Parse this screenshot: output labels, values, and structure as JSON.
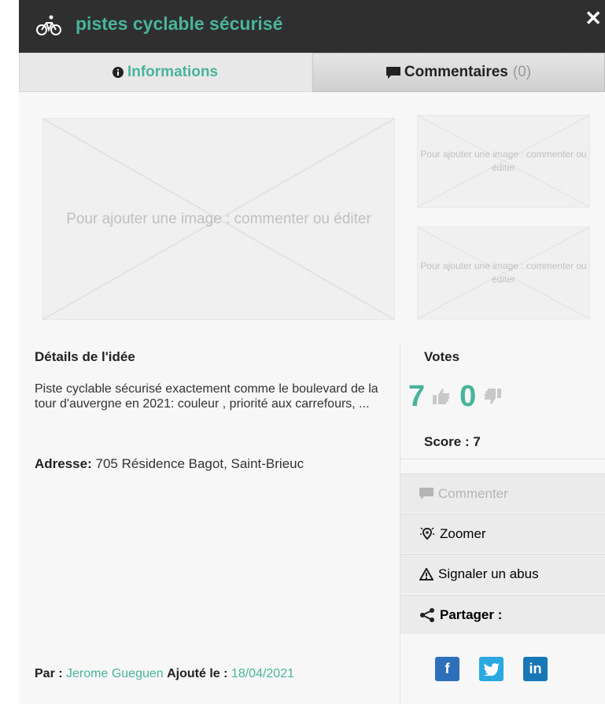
{
  "header": {
    "title": "pistes cyclable sécurisé",
    "close": "✕"
  },
  "tabs": {
    "info": "Informations",
    "comments": "Commentaires",
    "comments_count": "(0)"
  },
  "images": {
    "placeholder_main": "Pour ajouter une image : commenter ou éditer",
    "placeholder_small": "Pour ajouter une image : commenter ou éditer"
  },
  "details": {
    "title": "Détails de l'idée",
    "text": "Piste cyclable sécurisé exactement comme le boulevard de la tour d'auvergne en 2021: couleur , priorité aux carrefours, ...",
    "address_label": "Adresse:",
    "address": "705 Résidence Bagot, Saint-Brieuc"
  },
  "footer": {
    "by_label": "Par :",
    "author": "Jerome Gueguen",
    "added_label": "Ajouté le :",
    "date": "18/04/2021"
  },
  "votes": {
    "title": "Votes",
    "up": "7",
    "down": "0",
    "score": "Score : 7"
  },
  "actions": {
    "comment": "Commenter",
    "zoom": "Zoomer",
    "report": "Signaler un abus",
    "share": "Partager :"
  },
  "colors": {
    "accent": "#49b49b",
    "facebook": "#2d6fba",
    "twitter": "#2aa9e0",
    "linkedin": "#1877b6"
  }
}
